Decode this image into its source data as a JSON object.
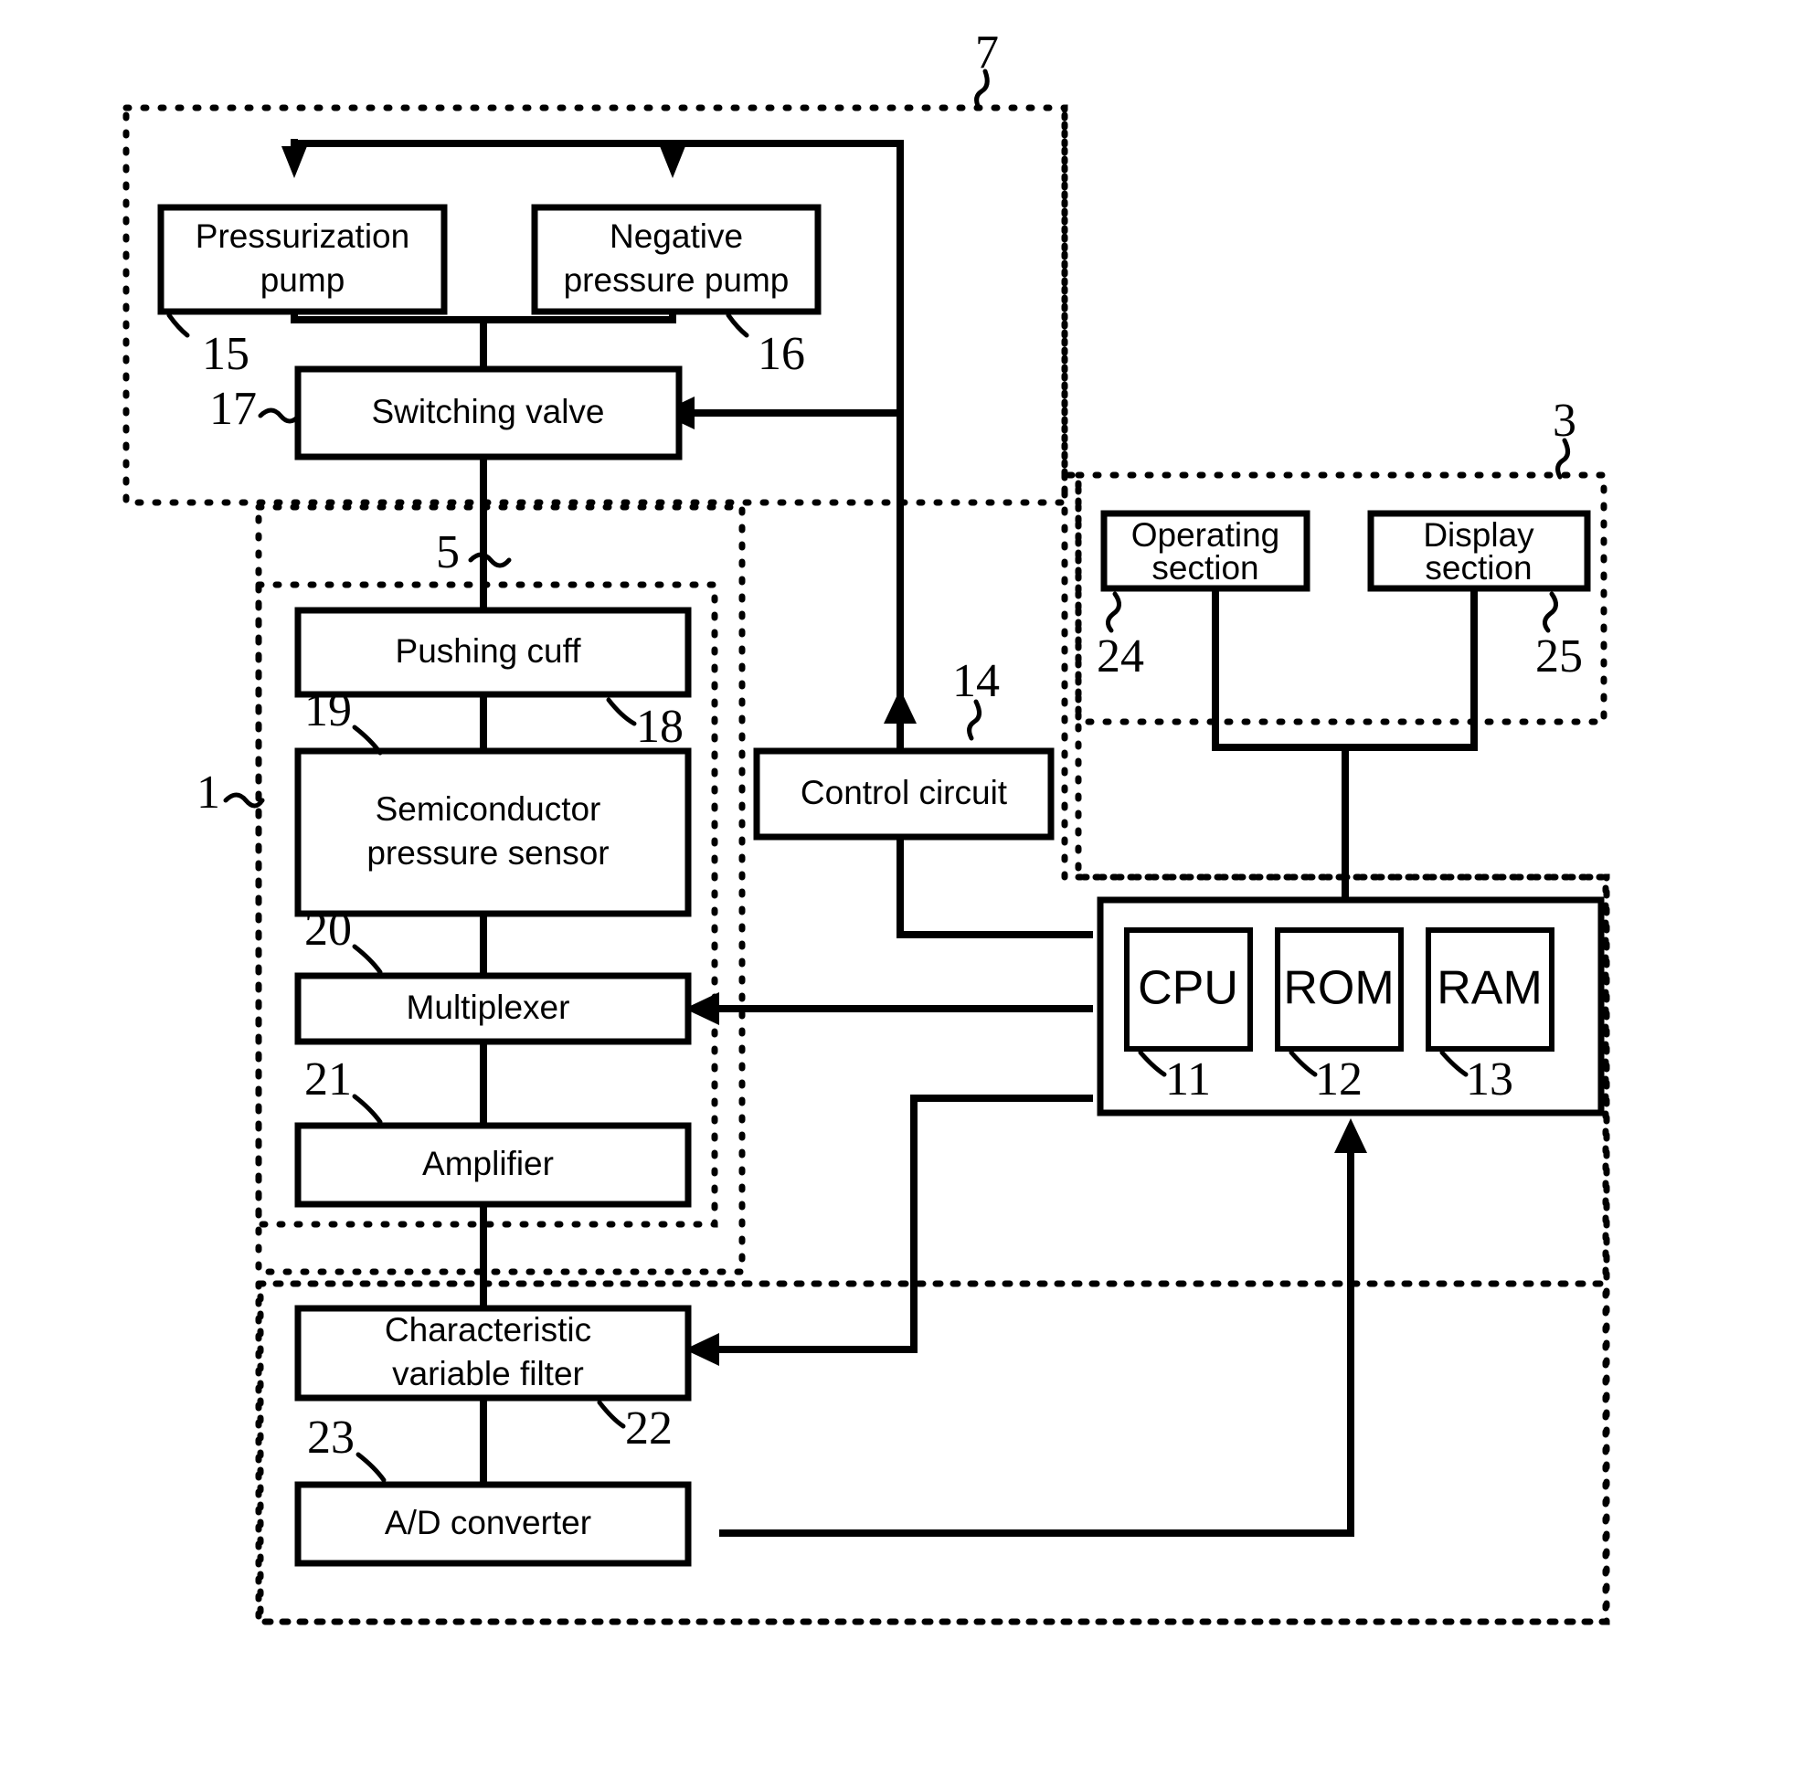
{
  "figure": {
    "kind": "patent-block-diagram",
    "background_color": "#ffffff",
    "line_color": "#000000"
  },
  "blocks": [
    {
      "id": "pressurization_pump",
      "label_line1": "Pressurization",
      "label_line2": "pump",
      "ref": "15"
    },
    {
      "id": "negative_pressure_pump",
      "label_line1": "Negative",
      "label_line2": "pressure pump",
      "ref": "16"
    },
    {
      "id": "switching_valve",
      "label_line1": "Switching valve",
      "label_line2": "",
      "ref": "17"
    },
    {
      "id": "pushing_cuff",
      "label_line1": "Pushing cuff",
      "label_line2": "",
      "ref": "18"
    },
    {
      "id": "semiconductor_pressure_sensor",
      "label_line1": "Semiconductor",
      "label_line2": "pressure sensor",
      "ref": "19"
    },
    {
      "id": "multiplexer",
      "label_line1": "Multiplexer",
      "label_line2": "",
      "ref": "20"
    },
    {
      "id": "amplifier",
      "label_line1": "Amplifier",
      "label_line2": "",
      "ref": "21"
    },
    {
      "id": "characteristic_variable_filter",
      "label_line1": "Characteristic",
      "label_line2": "variable filter",
      "ref": "22"
    },
    {
      "id": "ad_converter",
      "label_line1": "A/D converter",
      "label_line2": "",
      "ref": "23"
    },
    {
      "id": "control_circuit",
      "label_line1": "Control circuit",
      "label_line2": "",
      "ref": "14"
    },
    {
      "id": "operating_section",
      "label_line1": "Operating",
      "label_line2": "section",
      "ref": "24"
    },
    {
      "id": "display_section",
      "label_line1": "Display",
      "label_line2": "section",
      "ref": "25"
    },
    {
      "id": "cpu",
      "label_line1": "CPU",
      "label_line2": "",
      "ref": "11"
    },
    {
      "id": "rom",
      "label_line1": "ROM",
      "label_line2": "",
      "ref": "12"
    },
    {
      "id": "ram",
      "label_line1": "RAM",
      "label_line2": "",
      "ref": "13"
    }
  ],
  "groups": [
    {
      "id": "pneumatic_group",
      "ref": "7"
    },
    {
      "id": "cuff_sensor_group",
      "ref": "5"
    },
    {
      "id": "sensor_chain_group",
      "ref": "1"
    },
    {
      "id": "io_group",
      "ref": "3"
    },
    {
      "id": "processing_group",
      "ref": ""
    }
  ],
  "reference_numerals": {
    "n1": "1",
    "n3": "3",
    "n5": "5",
    "n7": "7",
    "n11": "11",
    "n12": "12",
    "n13": "13",
    "n14": "14",
    "n15": "15",
    "n16": "16",
    "n17": "17",
    "n18": "18",
    "n19": "19",
    "n20": "20",
    "n21": "21",
    "n22": "22",
    "n23": "23",
    "n24": "24",
    "n25": "25"
  },
  "labels": {
    "pressurization_pump_l1": "Pressurization",
    "pressurization_pump_l2": "pump",
    "negative_pressure_pump_l1": "Negative",
    "negative_pressure_pump_l2": "pressure pump",
    "switching_valve": "Switching valve",
    "pushing_cuff": "Pushing cuff",
    "semiconductor_sensor_l1": "Semiconductor",
    "semiconductor_sensor_l2": "pressure sensor",
    "multiplexer": "Multiplexer",
    "amplifier": "Amplifier",
    "char_variable_filter_l1": "Characteristic",
    "char_variable_filter_l2": "variable filter",
    "ad_converter": "A/D converter",
    "control_circuit": "Control circuit",
    "operating_section_l1": "Operating",
    "operating_section_l2": "section",
    "display_section_l1": "Display",
    "display_section_l2": "section",
    "cpu": "CPU",
    "rom": "ROM",
    "ram": "RAM"
  }
}
